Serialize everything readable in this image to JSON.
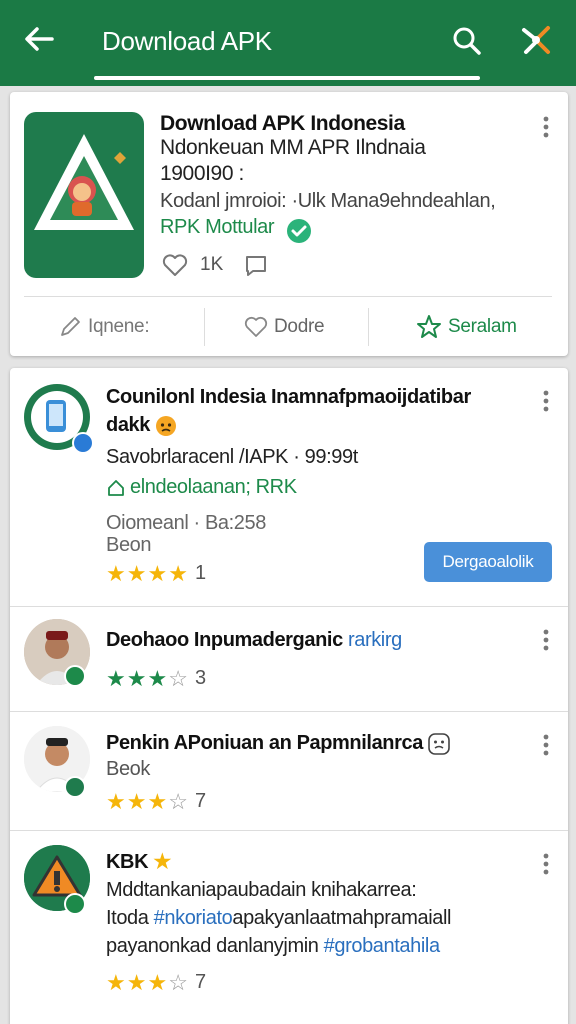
{
  "appbar": {
    "title": "Download APK",
    "icons": [
      "back-arrow-icon",
      "search-icon",
      "app-logo-icon"
    ],
    "color": "#1b7a45"
  },
  "featured": {
    "line1": "Download APK Indonesia",
    "line2": "Ndonkeuan MM APR Ilndnaia",
    "line3": "1900I90 :",
    "line4": "Kodanl jmroioi: ·Ulk Mana9ehndeahlan,",
    "line5": "RPK Mottular",
    "likes": "1K",
    "actions": {
      "edit": "Iqnene:",
      "like": "Dodre",
      "save": "Seralam"
    }
  },
  "items": [
    {
      "title": "Counilonl Indesia Inamnafpmaoijdatibar",
      "title2": "dakk",
      "meta": "Savobrlaracenl /IAPK · 99:99t",
      "tag": "elndeolaanan; RRK",
      "sub1": "Oiomeanl  · Ba:258",
      "sub2": "Beon",
      "rating": "1",
      "stars": 4,
      "download_label": "Dergaoalolik"
    },
    {
      "title_a": "Deohaoo Inpumaderganic",
      "title_b": "rarkirg",
      "rating": "3",
      "stars": 3
    },
    {
      "title": "Penkin APoniuan an Papmnilanrca",
      "sub": "Beok",
      "rating": "7",
      "stars": 3
    },
    {
      "title": "KBK",
      "line2": "Mddtankaniapaubadain knihakarrea:",
      "line3_a": "Itoda",
      "line3_b": "#nkoriato",
      "line3_c": "apakyanlaatmahpramaiall",
      "line4_a": "payanonkad danlanyjmin",
      "line4_b": "#grobantahila",
      "rating": "7",
      "stars": 3
    }
  ],
  "colors": {
    "primary_green": "#1b7a45",
    "star_gold": "#f5b50a",
    "link_blue": "#2a6fbe",
    "button_blue": "#4a90d9"
  }
}
